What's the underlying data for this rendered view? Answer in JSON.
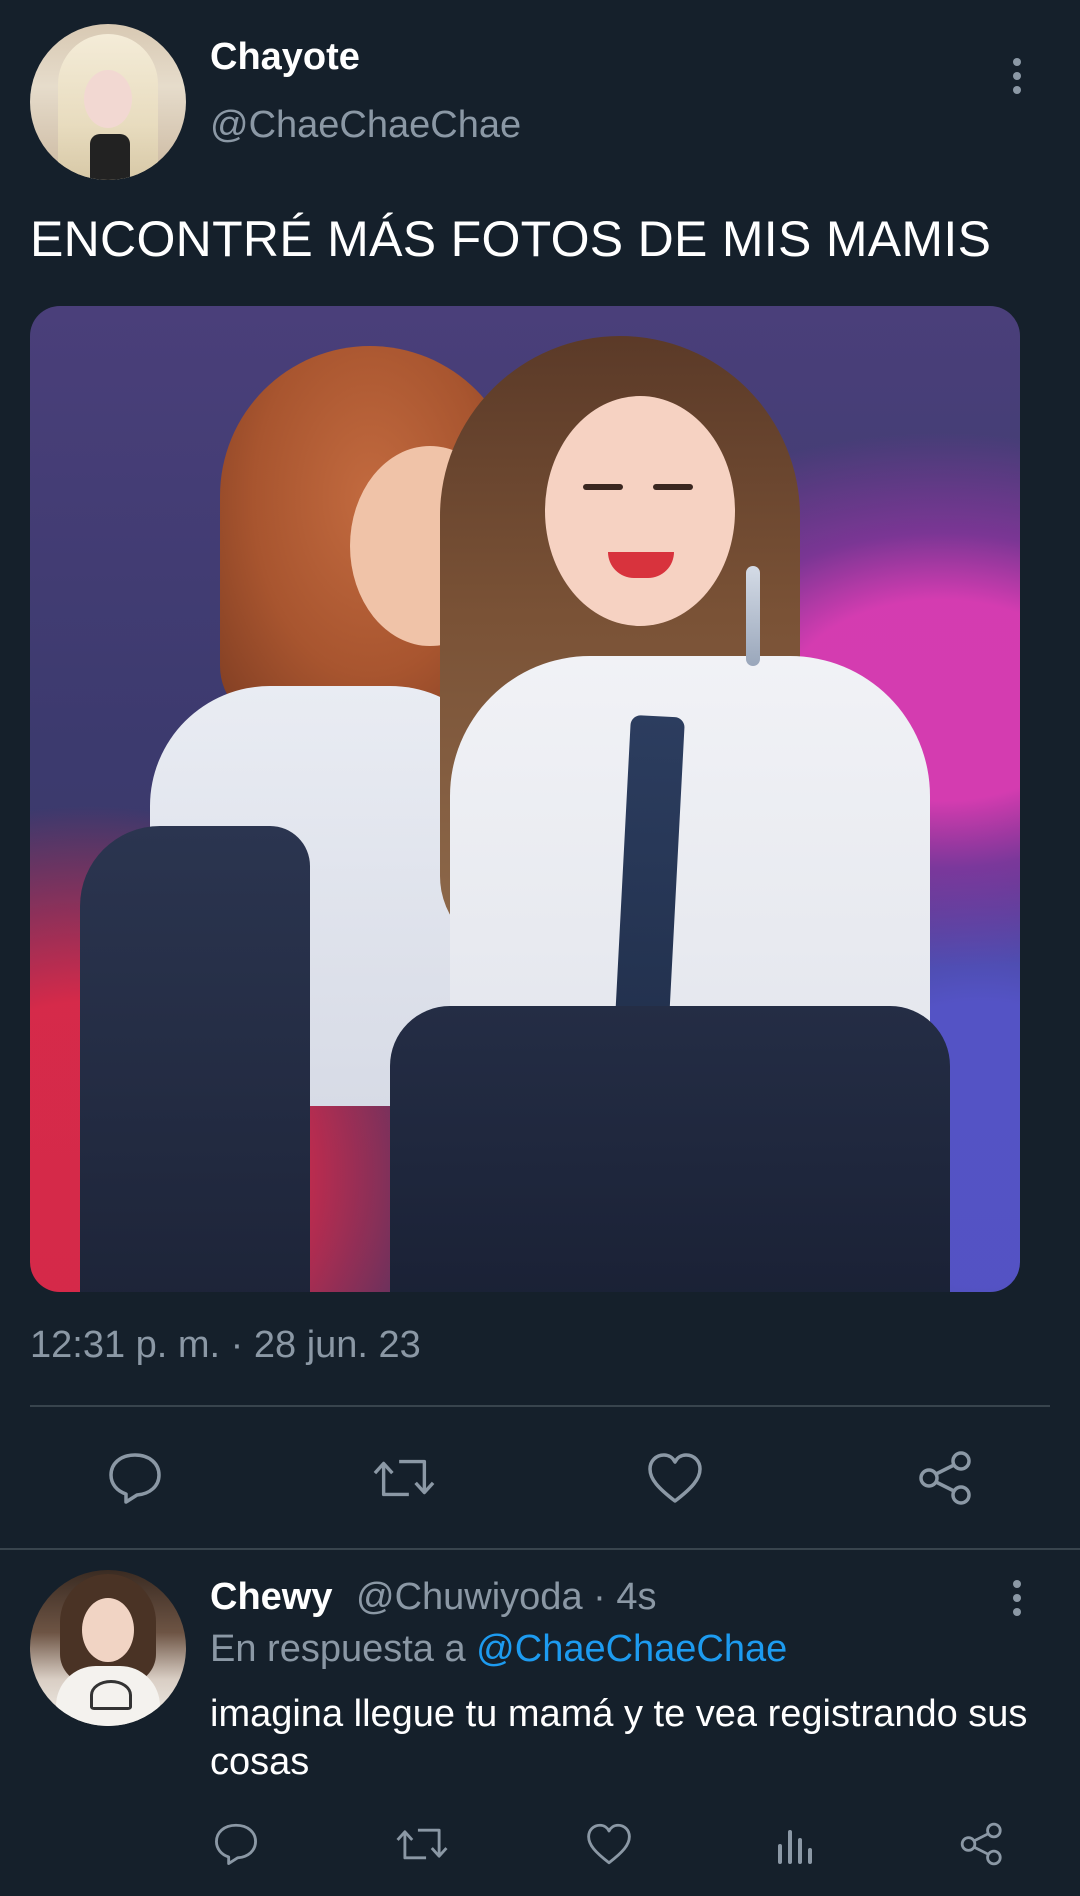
{
  "main_tweet": {
    "author": {
      "display_name": "Chayote",
      "handle": "@ChaeChaeChae"
    },
    "text": "ENCONTRÉ MÁS FOTOS DE MIS MAMIS",
    "timestamp": "12:31 p. m. · 28 jun. 23",
    "actions": [
      "reply-icon",
      "retweet-icon",
      "like-icon",
      "share-icon"
    ]
  },
  "reply": {
    "author": {
      "display_name": "Chewy",
      "handle_time": "@Chuwiyoda · 4s"
    },
    "reply_to_prefix": "En respuesta a",
    "reply_to_handle": "@ChaeChaeChae",
    "text": "imagina llegue tu mamá y te vea registrando sus cosas",
    "actions": [
      "reply-icon",
      "retweet-icon",
      "like-icon",
      "views-icon",
      "share-icon"
    ]
  },
  "colors": {
    "background": "#15202b",
    "secondary_text": "#8b98a5",
    "link": "#1d9bf0",
    "divider": "#38444d"
  }
}
